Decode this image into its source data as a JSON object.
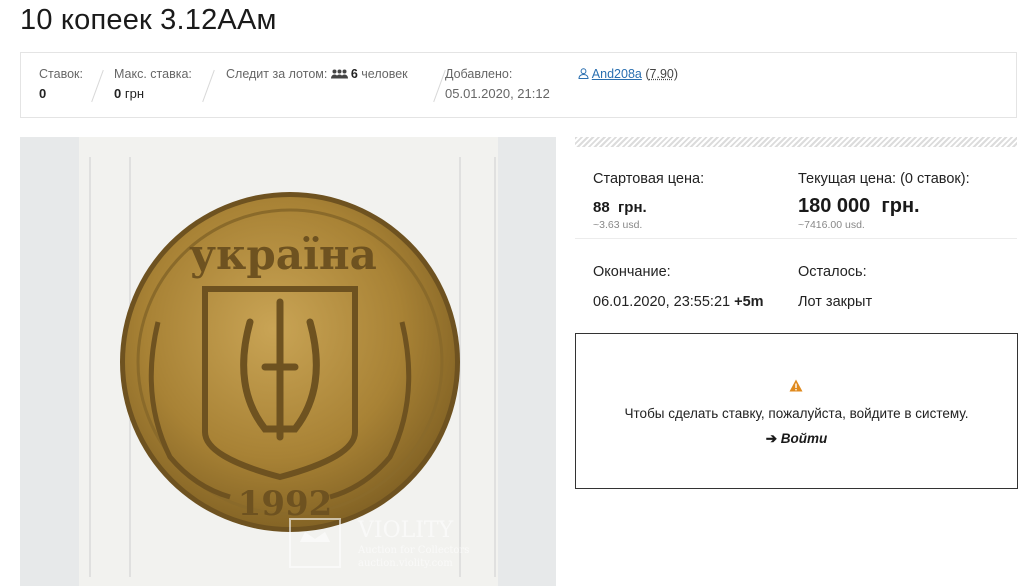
{
  "lot": {
    "title": "10 копеек 3.12ААм"
  },
  "stats": {
    "bids_label": "Ставок:",
    "bids_value": "0",
    "max_bid_label": "Макс. ставка:",
    "max_bid_value": "0",
    "max_bid_currency": "грн",
    "watchers_label": "Следит за лотом:",
    "watchers_count": "6",
    "watchers_unit": "человек",
    "added_label": "Добавлено:",
    "added_value": "05.01.2020, 21:12",
    "seller_name": "And208a",
    "seller_rating": "7.90"
  },
  "photo": {
    "coin_legend": "україна",
    "coin_year": "1992",
    "watermark_name": "VIOLITY",
    "watermark_sub": "Auction for Collectors",
    "watermark_url": "auction.violity.com"
  },
  "prices": {
    "start_label": "Стартовая цена:",
    "start_value": "88",
    "start_currency": "грн.",
    "start_usd": "~3.63  usd.",
    "current_label": "Текущая цена: (0 ставок):",
    "current_value": "180 000",
    "current_currency": "грн.",
    "current_usd": "~7416.00  usd.",
    "end_label": "Окончание:",
    "end_value": "06.01.2020, 23:55:21",
    "end_extension": "+5m",
    "remaining_label": "Осталось:",
    "remaining_value": "Лот закрыт"
  },
  "login": {
    "message": "Чтобы сделать ставку, пожалуйста, войдите в систему.",
    "link_label": "Войти"
  },
  "colors": {
    "link": "#2a6fb0",
    "warning": "#e08a1e",
    "coin_gold": "#b08a3e"
  }
}
